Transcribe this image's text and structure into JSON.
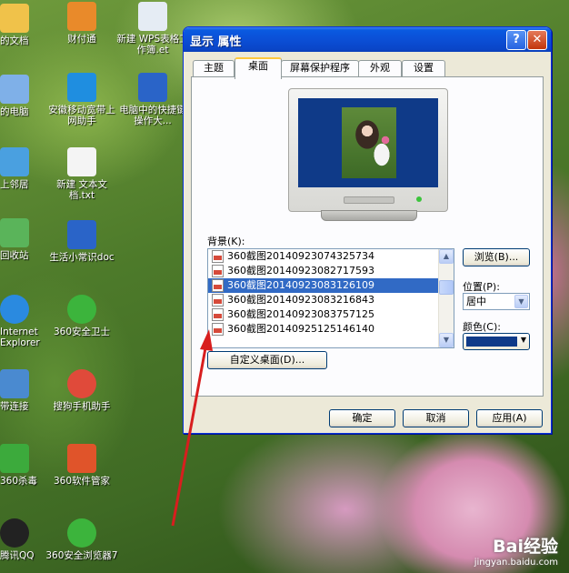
{
  "desktop_icons": [
    {
      "id": "documents",
      "label": "的文档",
      "color": "#f0c24a"
    },
    {
      "id": "caifutong",
      "label": "财付通",
      "color": "#e98a2a"
    },
    {
      "id": "wps",
      "label": "新建 WPS表格工作簿.et",
      "color": "#e5ecf4"
    },
    {
      "id": "mycomputer",
      "label": "的电脑",
      "color": "#7fb0e8"
    },
    {
      "id": "mobile",
      "label": "安徽移动宽带上网助手",
      "color": "#1f8ee0"
    },
    {
      "id": "computer-shortcut",
      "label": "电脑中的快捷键操作大...",
      "color": "#2a64c8"
    },
    {
      "id": "network",
      "label": "上邻居",
      "color": "#4aa0e0"
    },
    {
      "id": "txt",
      "label": "新建 文本文档.txt",
      "color": "#f4f4f4"
    },
    {
      "id": "recycle",
      "label": "回收站",
      "color": "#5ab45a"
    },
    {
      "id": "doc",
      "label": "生活小常识doc",
      "color": "#2a64c8"
    },
    {
      "id": "ie",
      "label": "Internet Explorer",
      "color": "#2a8ae0"
    },
    {
      "id": "360safe",
      "label": "360安全卫士",
      "color": "#3cb43c"
    },
    {
      "id": "broadband",
      "label": "带连接",
      "color": "#4a8ad0"
    },
    {
      "id": "sogou",
      "label": "搜狗手机助手",
      "color": "#e04a3a"
    },
    {
      "id": "360av",
      "label": "360杀毒",
      "color": "#3caa3c"
    },
    {
      "id": "360manager",
      "label": "360软件管家",
      "color": "#e0542a"
    },
    {
      "id": "qq",
      "label": "腾讯QQ",
      "color": "#222222"
    },
    {
      "id": "360browser",
      "label": "360安全浏览器7",
      "color": "#3cb43c"
    }
  ],
  "dialog": {
    "title": "显示 属性",
    "help_label": "?",
    "close_label": "✕",
    "tabs": [
      {
        "label": "主题"
      },
      {
        "label": "桌面",
        "active": true
      },
      {
        "label": "屏幕保护程序"
      },
      {
        "label": "外观"
      },
      {
        "label": "设置"
      }
    ],
    "background_label": "背景(K):",
    "backgrounds": [
      "360截图20140923074325734",
      "360截图20140923082717593",
      "360截图20140923083126109",
      "360截图20140923083216843",
      "360截图20140923083757125",
      "360截图20140925125146140"
    ],
    "selected_background_index": 2,
    "browse_label": "浏览(B)...",
    "position_label": "位置(P):",
    "position_value": "居中",
    "color_label": "颜色(C):",
    "color_value": "#0f3a88",
    "customize_label": "自定义桌面(D)...",
    "ok_label": "确定",
    "cancel_label": "取消",
    "apply_label": "应用(A)"
  },
  "annotation_arrow_color": "#d81e1e",
  "watermark": {
    "logo": "Bai经验",
    "url": "jingyan.baidu.com"
  }
}
